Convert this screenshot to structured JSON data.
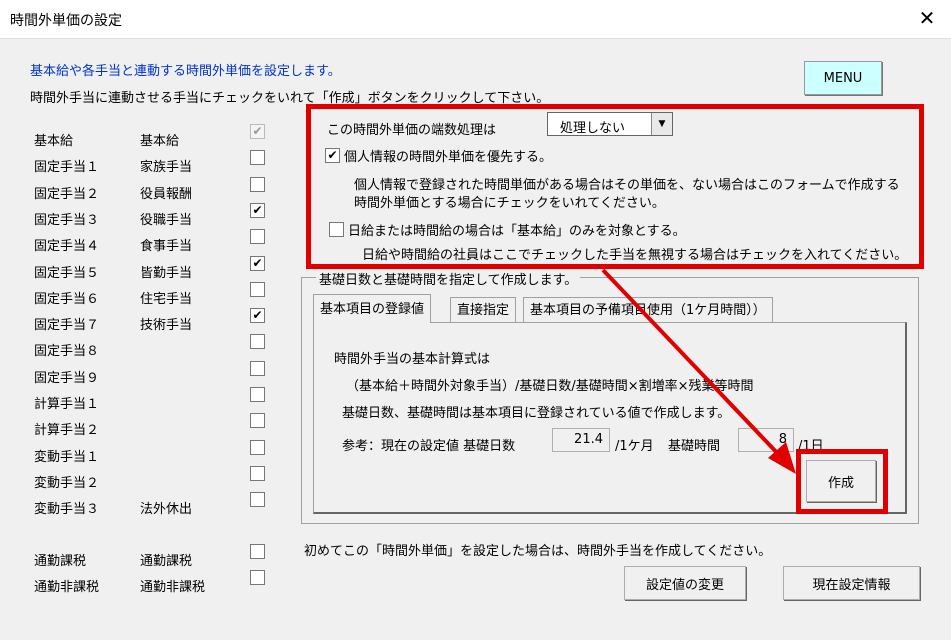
{
  "window": {
    "title": "時間外単価の設定",
    "close_glyph": "✕"
  },
  "intro": {
    "line1": "基本給や各手当と連動する時間外単価を設定します。",
    "line2": "時間外手当に連動させる手当にチェックをいれて「作成」ボタンをクリックして下さい。"
  },
  "menu_button": "MENU",
  "allowances": [
    {
      "category": "基本給",
      "name": "基本給",
      "checked": true,
      "disabled": true
    },
    {
      "category": "固定手当１",
      "name": "家族手当",
      "checked": false
    },
    {
      "category": "固定手当２",
      "name": "役員報酬",
      "checked": false
    },
    {
      "category": "固定手当３",
      "name": "役職手当",
      "checked": true
    },
    {
      "category": "固定手当４",
      "name": "食事手当",
      "checked": false
    },
    {
      "category": "固定手当５",
      "name": "皆勤手当",
      "checked": true
    },
    {
      "category": "固定手当６",
      "name": "住宅手当",
      "checked": false
    },
    {
      "category": "固定手当７",
      "name": "技術手当",
      "checked": true
    },
    {
      "category": "固定手当８",
      "name": "",
      "checked": false
    },
    {
      "category": "固定手当９",
      "name": "",
      "checked": false
    },
    {
      "category": "計算手当１",
      "name": "",
      "checked": false
    },
    {
      "category": "計算手当２",
      "name": "",
      "checked": false
    },
    {
      "category": "変動手当１",
      "name": "",
      "checked": false
    },
    {
      "category": "変動手当２",
      "name": "",
      "checked": false
    },
    {
      "category": "変動手当３",
      "name": "法外休出",
      "checked": false
    }
  ],
  "commute": [
    {
      "category": "通勤課税",
      "name": "通勤課税",
      "checked": false
    },
    {
      "category": "通勤非課税",
      "name": "通勤非課税",
      "checked": false
    }
  ],
  "rounding": {
    "label": "この時間外単価の端数処理は",
    "selected": "処理しない",
    "arrow_glyph": "▼"
  },
  "personal_priority": {
    "label": "個人情報の時間外単価を優先する。",
    "checked": true,
    "desc1": "個人情報で登録された時間単価がある場合はその単価を、ない場合はこのフォームで作成する",
    "desc2": "時間外単価とする場合にチェックをいれてください。"
  },
  "daily_hourly": {
    "label": "日給または時間給の場合は「基本給」のみを対象とする。",
    "checked": false,
    "desc": "日給や時間給の社員はここでチェックした手当を無視する場合はチェックを入れてください。"
  },
  "group": {
    "label": "基礎日数と基礎時間を指定して作成します。",
    "tabs": [
      "基本項目の登録値",
      "直接指定",
      "基本項目の予備項目使用（1ケ月時間））"
    ],
    "formula_title": "時間外手当の基本計算式は",
    "formula": "（基本給＋時間外対象手当）/基礎日数/基礎時間×割増率×残業等時間",
    "note": "基礎日数、基礎時間は基本項目に登録されている値で作成します。",
    "ref_label": "参考：現在の設定値 基礎日数",
    "days_value": "21.4",
    "days_unit": "/1ケ月",
    "hours_label": "基礎時間",
    "hours_value": "8",
    "hours_unit": "/1日",
    "create_button": "作成"
  },
  "footer": {
    "note": "初めてこの「時間外単価」を設定した場合は、時間外手当を作成してください。",
    "change_button": "設定値の変更",
    "current_button": "現在設定情報"
  },
  "colors": {
    "highlight": "#e00000",
    "menu_bg": "#ccffff",
    "intro_text": "#0033cc"
  }
}
